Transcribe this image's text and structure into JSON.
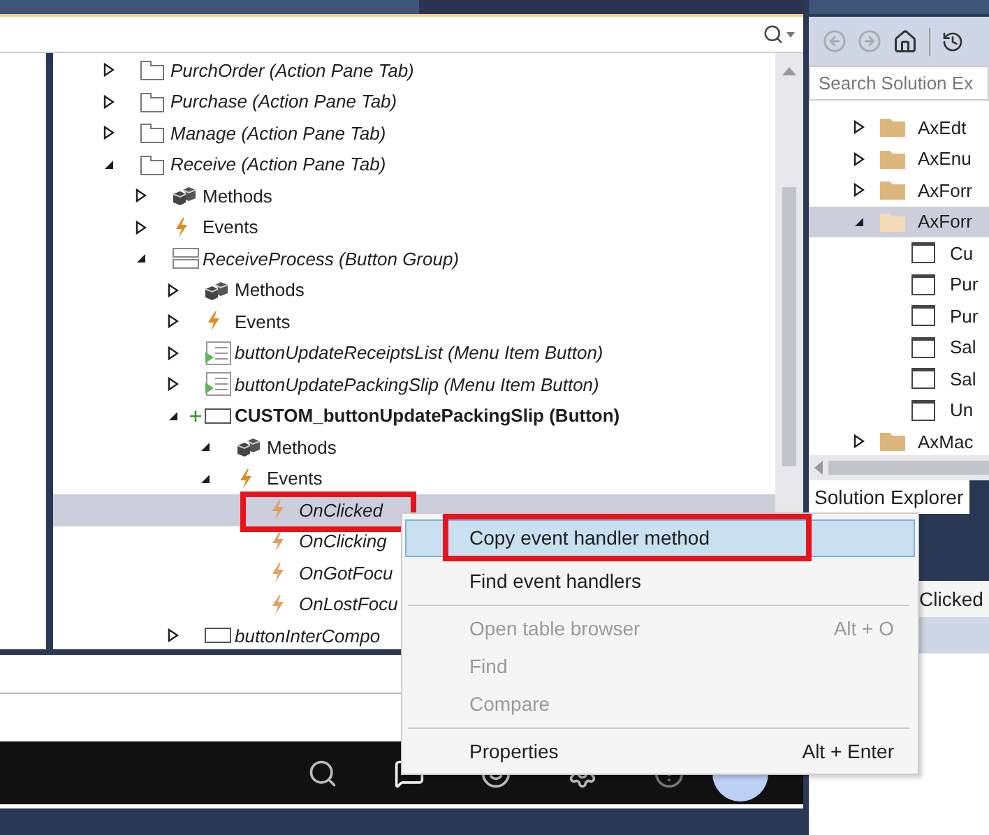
{
  "tree": [
    {
      "label": "PurchOrder (Action Pane Tab)",
      "kind": "tab",
      "expanded": false
    },
    {
      "label": "Purchase (Action Pane Tab)",
      "kind": "tab",
      "expanded": false
    },
    {
      "label": "Manage (Action Pane Tab)",
      "kind": "tab",
      "expanded": false
    },
    {
      "label": "Receive (Action Pane Tab)",
      "kind": "tab",
      "expanded": true,
      "children": [
        {
          "label": "Methods",
          "kind": "methods",
          "expanded": false
        },
        {
          "label": "Events",
          "kind": "events",
          "expanded": false
        },
        {
          "label": "ReceiveProcess (Button Group)",
          "kind": "group",
          "expanded": true,
          "children": [
            {
              "label": "Methods",
              "kind": "methods",
              "expanded": false
            },
            {
              "label": "Events",
              "kind": "events",
              "expanded": false
            },
            {
              "label": "buttonUpdateReceiptsList (Menu Item Button)",
              "kind": "menuitem",
              "expanded": false
            },
            {
              "label": "buttonUpdatePackingSlip (Menu Item Button)",
              "kind": "menuitem",
              "expanded": false
            },
            {
              "label": "CUSTOM_buttonUpdatePackingSlip (Button)",
              "kind": "button",
              "added": true,
              "expanded": true,
              "children": [
                {
                  "label": "Methods",
                  "kind": "methods",
                  "expanded": true
                },
                {
                  "label": "Events",
                  "kind": "events",
                  "expanded": true,
                  "children": [
                    {
                      "label": "OnClicked",
                      "kind": "event",
                      "selected": true
                    },
                    {
                      "label": "OnClicking",
                      "kind": "event",
                      "selected": false
                    },
                    {
                      "label": "OnGotFocu",
                      "kind": "event",
                      "selected": false
                    },
                    {
                      "label": "OnLostFocu",
                      "kind": "event",
                      "selected": false
                    }
                  ]
                }
              ]
            },
            {
              "label": "buttonInterCompo",
              "kind": "button",
              "added": false,
              "expanded": false
            }
          ]
        }
      ]
    }
  ],
  "solution_explorer": {
    "search_placeholder": "Search Solution Ex",
    "items": [
      {
        "label": "AxEdt",
        "kind": "folder",
        "expanded": false,
        "selected": false
      },
      {
        "label": "AxEnu",
        "kind": "folder",
        "expanded": false,
        "selected": false
      },
      {
        "label": "AxForr",
        "kind": "folder",
        "expanded": false,
        "selected": false
      },
      {
        "label": "AxForr",
        "kind": "folder",
        "expanded": true,
        "selected": true,
        "children": [
          {
            "label": "Cu",
            "kind": "form",
            "selected": false
          },
          {
            "label": "Pur",
            "kind": "form",
            "selected": false
          },
          {
            "label": "Pur",
            "kind": "form",
            "selected": false
          },
          {
            "label": "Sal",
            "kind": "form",
            "selected": false
          },
          {
            "label": "Sal",
            "kind": "form",
            "selected": false
          },
          {
            "label": "Un",
            "kind": "form",
            "selected": false
          }
        ]
      },
      {
        "label": "AxMac",
        "kind": "folder",
        "expanded": false,
        "selected": false
      }
    ],
    "tab": "Solution Explorer",
    "properties_title": "Clicked"
  },
  "context_menu": [
    {
      "kind": "item",
      "label": "Copy event handler method",
      "highlighted": true,
      "disabled": false
    },
    {
      "kind": "item",
      "label": "Find event handlers",
      "highlighted": false,
      "disabled": false
    },
    {
      "kind": "separator"
    },
    {
      "kind": "item",
      "label": "Open table browser",
      "shortcut": "Alt + O",
      "highlighted": false,
      "disabled": true
    },
    {
      "kind": "item",
      "label": "Find",
      "highlighted": false,
      "disabled": true
    },
    {
      "kind": "item",
      "label": "Compare",
      "highlighted": false,
      "disabled": true
    },
    {
      "kind": "separator"
    },
    {
      "kind": "item",
      "label": "Properties",
      "shortcut": "Alt + Enter",
      "highlighted": false,
      "disabled": false
    }
  ]
}
